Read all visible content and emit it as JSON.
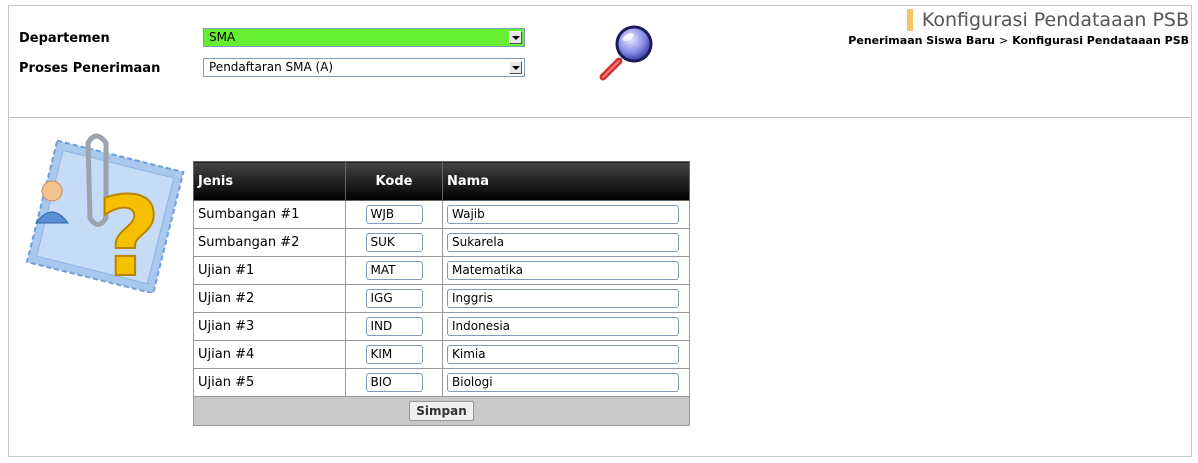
{
  "filters": {
    "departemen_label": "Departemen",
    "departemen_value": "SMA",
    "proses_label": "Proses Penerimaan",
    "proses_value": "Pendaftaran SMA (A)"
  },
  "header": {
    "title": "Konfigurasi Pendataaan PSB",
    "breadcrumb_parent": "Penerimaan Siswa Baru",
    "breadcrumb_separator": ">",
    "breadcrumb_current": "Konfigurasi Pendataaan PSB"
  },
  "table": {
    "columns": [
      "Jenis",
      "Kode",
      "Nama"
    ],
    "rows": [
      {
        "jenis": "Sumbangan #1",
        "kode": "WJB",
        "nama": "Wajib"
      },
      {
        "jenis": "Sumbangan #2",
        "kode": "SUK",
        "nama": "Sukarela"
      },
      {
        "jenis": "Ujian #1",
        "kode": "MAT",
        "nama": "Matematika"
      },
      {
        "jenis": "Ujian #2",
        "kode": "IGG",
        "nama": "Inggris"
      },
      {
        "jenis": "Ujian #3",
        "kode": "IND",
        "nama": "Indonesia"
      },
      {
        "jenis": "Ujian #4",
        "kode": "KIM",
        "nama": "Kimia"
      },
      {
        "jenis": "Ujian #5",
        "kode": "BIO",
        "nama": "Biologi"
      }
    ],
    "save_label": "Simpan"
  },
  "colors": {
    "departemen_bg": "#66ee33",
    "title_accent": "#f6c563",
    "table_header": "#000000",
    "table_footer": "#c9c9c9"
  },
  "icons": {
    "search": "magnifier-icon",
    "illustration": "help-stamp-icon"
  }
}
